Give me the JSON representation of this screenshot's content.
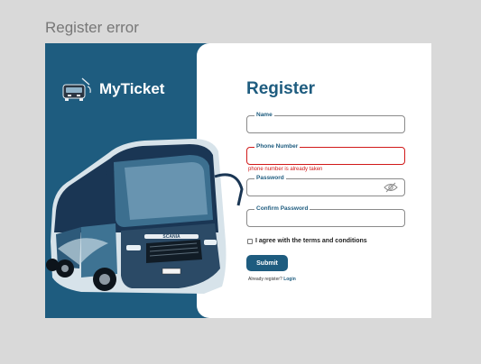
{
  "frame": {
    "label": "Register error"
  },
  "brand": {
    "name": "MyTicket",
    "logo_icon": "bus-icon"
  },
  "form": {
    "title": "Register",
    "fields": {
      "name": {
        "label": "Name",
        "value": ""
      },
      "phone": {
        "label": "Phone Number",
        "value": "",
        "error": "phone number is already taken"
      },
      "password": {
        "label": "Password",
        "value": "",
        "toggle_icon": "eye-off-icon"
      },
      "confirm": {
        "label": "Confirm Password",
        "value": ""
      }
    },
    "terms_label": "I agree with the terms and conditions",
    "submit_label": "Submit",
    "login_prompt": "Already register?",
    "login_link": "Login"
  },
  "bus": {
    "brand_text": "SCANIA"
  },
  "colors": {
    "primary": "#1e5c7f",
    "error": "#d11a1a",
    "background": "#d9d9d9"
  }
}
